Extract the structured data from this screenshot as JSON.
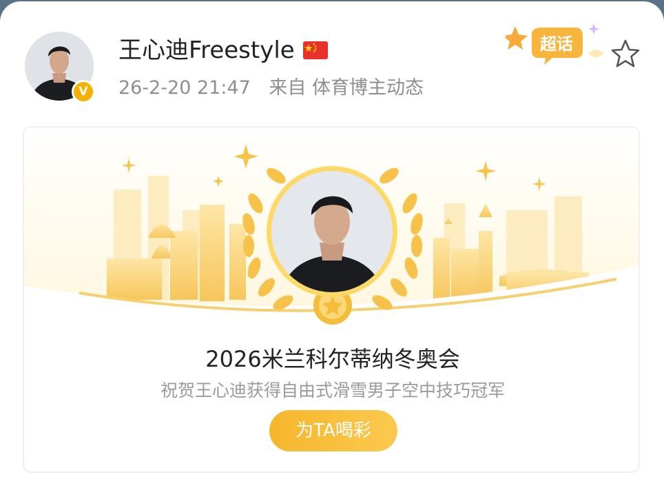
{
  "post": {
    "username": "王心迪Freestyle",
    "timestamp": "26-2-20 21:47",
    "source": "来自 体育博主动态",
    "flag_icon": "china-flag-icon",
    "verified_badge": "V",
    "verified_color": "#f6b100"
  },
  "header": {
    "supertopic_label": "超话",
    "favorite_icon": "star-outline-icon"
  },
  "card": {
    "title": "2026米兰科尔蒂纳冬奥会",
    "subtitle": "祝贺王心迪获得自由式滑雪男子空中技巧冠军",
    "cheer_button": "为TA喝彩",
    "accent_color": "#f6b62c"
  }
}
